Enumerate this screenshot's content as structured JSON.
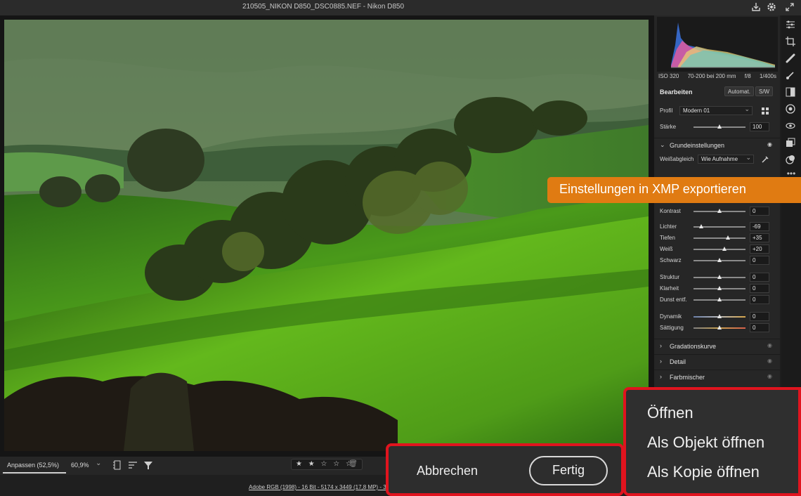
{
  "window": {
    "title": "210505_NIKON D850_DSC0885.NEF  -  Nikon D850"
  },
  "camera_info": {
    "iso": "ISO 320",
    "lens": "70-200 bei 200 mm",
    "aperture": "f/8",
    "shutter": "1/400s"
  },
  "edit": {
    "title": "Bearbeiten",
    "auto_label": "Automat.",
    "bw_label": "S/W",
    "profile_label": "Profil",
    "profile_value": "Modern 01",
    "amount_label": "Stärke",
    "amount_value": "100",
    "amount_level": 0.5
  },
  "basic": {
    "title": "Grundeinstellungen",
    "wb_label": "Weißabgleich",
    "wb_value": "Wie Aufnahme",
    "sliders": [
      {
        "label": "Kontrast",
        "value": "0",
        "pos": 0.5
      },
      {
        "label": "Lichter",
        "value": "-69",
        "pos": 0.16
      },
      {
        "label": "Tiefen",
        "value": "+35",
        "pos": 0.67
      },
      {
        "label": "Weiß",
        "value": "+20",
        "pos": 0.6
      },
      {
        "label": "Schwarz",
        "value": "0",
        "pos": 0.5
      },
      {
        "label": "Struktur",
        "value": "0",
        "pos": 0.5
      },
      {
        "label": "Klarheit",
        "value": "0",
        "pos": 0.5
      },
      {
        "label": "Dunst entf.",
        "value": "0",
        "pos": 0.5
      },
      {
        "label": "Dynamik",
        "value": "0",
        "pos": 0.5
      },
      {
        "label": "Sättigung",
        "value": "0",
        "pos": 0.5
      }
    ]
  },
  "sections": [
    {
      "label": "Gradationskurve"
    },
    {
      "label": "Detail"
    },
    {
      "label": "Farbmischer"
    }
  ],
  "tooltip": {
    "text": "Einstellungen in XMP exportieren"
  },
  "bottombar": {
    "fit_label": "Anpassen (52,5%)",
    "zoom_value": "60,9%",
    "stars_text": "★ ★ ☆ ☆ ☆",
    "rating": 2
  },
  "statusbar": {
    "info": "Adobe RGB (1998) - 16 Bit - 5174 x 3449 (17,8 MP) - 3"
  },
  "dialog": {
    "cancel_label": "Abbrechen",
    "done_label": "Fertig"
  },
  "open_menu": {
    "items": [
      {
        "label": "Öffnen"
      },
      {
        "label": "Als Objekt öffnen"
      },
      {
        "label": "Als Kopie öffnen"
      }
    ]
  },
  "colors": {
    "accent_orange": "#e07b12",
    "highlight_red": "#e0141e",
    "panel_bg": "#262626"
  }
}
